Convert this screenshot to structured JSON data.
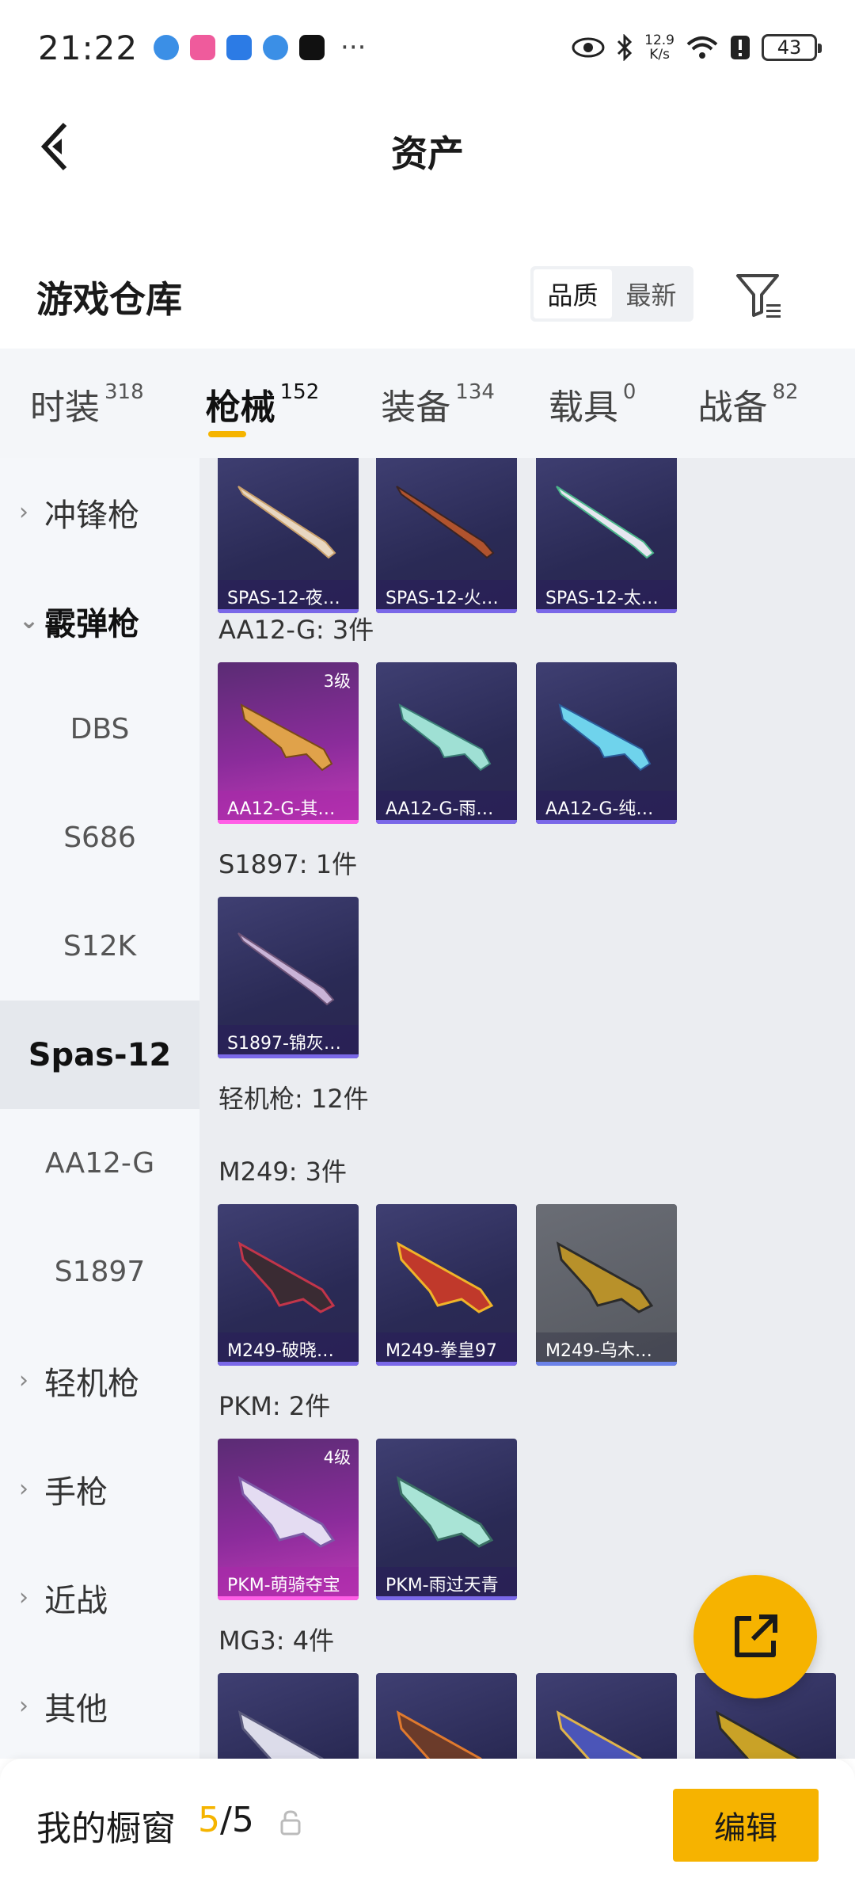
{
  "status_bar": {
    "time": "21:22",
    "net_speed_value": "12.9",
    "net_speed_unit": "K/s",
    "battery": "43",
    "more": "···"
  },
  "header": {
    "title": "资产"
  },
  "section": {
    "title": "游戏仓库",
    "sort_options": [
      "品质",
      "最新"
    ],
    "sort_active": "品质"
  },
  "tabs": [
    {
      "label": "时装",
      "count": "318"
    },
    {
      "label": "枪械",
      "count": "152"
    },
    {
      "label": "装备",
      "count": "134"
    },
    {
      "label": "载具",
      "count": "0"
    },
    {
      "label": "战备",
      "count": "82"
    }
  ],
  "sidebar": [
    {
      "label": "冲锋枪"
    },
    {
      "label": "霰弹枪"
    },
    {
      "label": "DBS"
    },
    {
      "label": "S686"
    },
    {
      "label": "S12K"
    },
    {
      "label": "Spas-12"
    },
    {
      "label": "AA12-G"
    },
    {
      "label": "S1897"
    },
    {
      "label": "轻机枪"
    },
    {
      "label": "手枪"
    },
    {
      "label": "近战"
    },
    {
      "label": "其他"
    }
  ],
  "groups": {
    "aa12g": "AA12-G: 3件",
    "s1897": "S1897: 1件",
    "lmg": "轻机枪: 12件",
    "m249": "M249: 3件",
    "pkm": "PKM: 2件",
    "mg3": "MG3: 4件"
  },
  "cards": {
    "spas": [
      "SPAS-12-夜…",
      "SPAS-12-火…",
      "SPAS-12-太…"
    ],
    "aa12g": [
      "AA12-G-其…",
      "AA12-G-雨…",
      "AA12-G-纯…"
    ],
    "aa12g_level": "3级",
    "s1897": [
      "S1897-锦灰…"
    ],
    "m249": [
      "M249-破晓…",
      "M249-拳皇97",
      "M249-乌木…"
    ],
    "pkm": [
      "PKM-萌骑夺宝",
      "PKM-雨过天青"
    ],
    "pkm_level": "4级"
  },
  "bottom_bar": {
    "label": "我的橱窗",
    "current": "5",
    "separator": "/",
    "max": "5",
    "edit": "编辑"
  },
  "colors": {
    "accent": "#f6b300",
    "legendary": "#c23bb6",
    "epic": "#3f3f72"
  }
}
